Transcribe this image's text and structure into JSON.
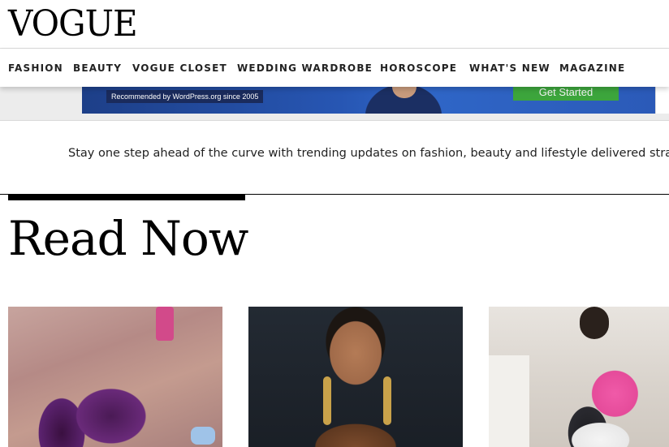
{
  "header": {
    "logo": "VOGUE"
  },
  "nav": {
    "items": [
      {
        "label": "FASHION"
      },
      {
        "label": "BEAUTY"
      },
      {
        "label": "VOGUE CLOSET"
      },
      {
        "label": "WEDDING WARDROBE"
      },
      {
        "label": "HOROSCOPE"
      },
      {
        "label": "WHAT'S NEW"
      },
      {
        "label": "MAGAZINE"
      }
    ]
  },
  "ad": {
    "tagline": "Recommended by WordPress.org since 2005",
    "cta": "Get Started"
  },
  "subscribe": {
    "text": "Stay one step ahead of the curve with trending updates on fashion, beauty and lifestyle delivered straigh"
  },
  "section": {
    "title": "Read Now"
  },
  "cards": [
    {
      "image": "woman-purple-gown-on-running-track"
    },
    {
      "image": "woman-with-gold-earrings-portrait"
    },
    {
      "image": "woman-in-pink-top-at-gym"
    }
  ]
}
